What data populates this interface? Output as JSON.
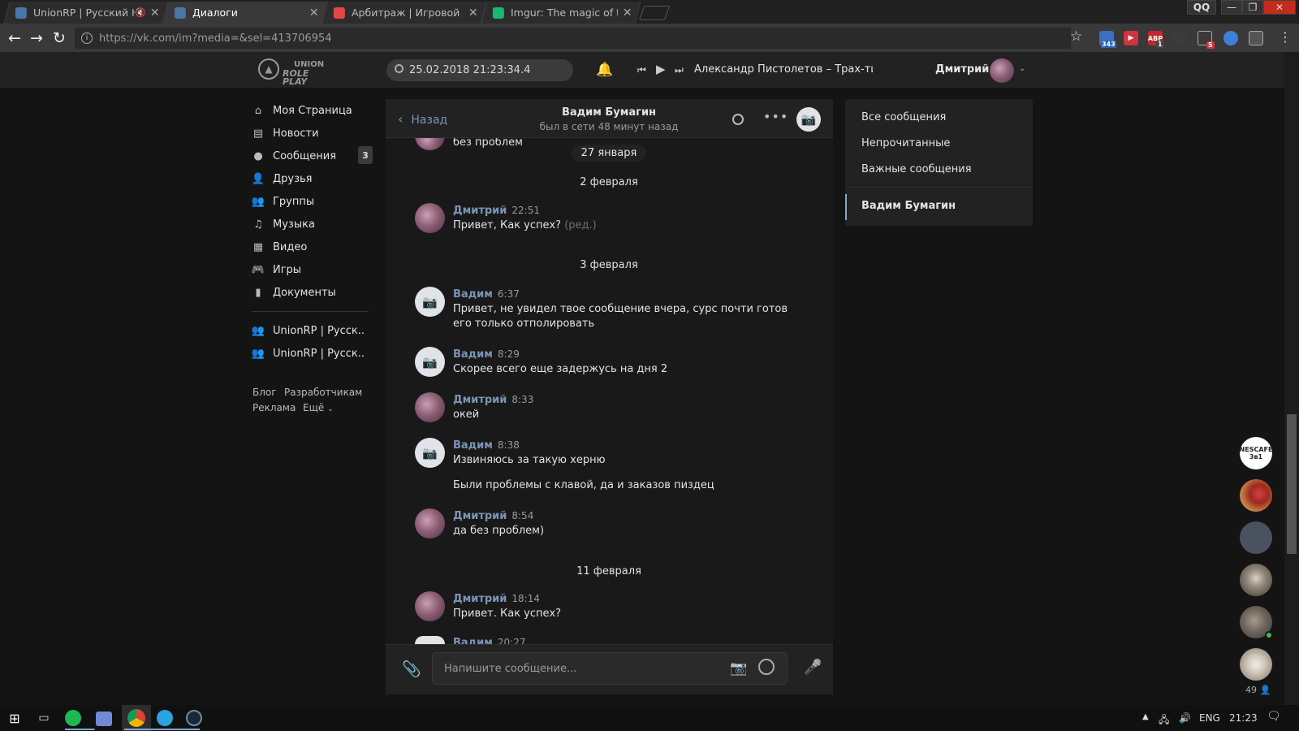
{
  "browser": {
    "tabs": [
      {
        "title": "UnionRP | Русский Hi",
        "muted": true,
        "favicon_color": "#4a76a8"
      },
      {
        "title": "Диалоги",
        "active": true,
        "favicon_color": "#4a76a8"
      },
      {
        "title": "Арбитраж | Игровой фо",
        "favicon_color": "#e04848"
      },
      {
        "title": "Imgur: The magic of the",
        "favicon_color": "#1bb76e"
      }
    ],
    "window_badge": "QQ",
    "url": "https://vk.com/im?media=&sel=413706954",
    "extensions": [
      {
        "name": "ext-weather-icon",
        "badge": "343",
        "color": "#3a6fc4"
      },
      {
        "name": "ext-video-icon",
        "badge": "",
        "color": "#d2333d"
      },
      {
        "name": "adblock-icon",
        "badge": "1",
        "label": "ABP",
        "color": "#c0282d"
      },
      {
        "name": "ext-gray-icon",
        "badge": "",
        "color": "#4a4a4a"
      },
      {
        "name": "ext-downloader-icon",
        "badge": "5",
        "color": "#555"
      },
      {
        "name": "ext-vpn-icon",
        "badge": "",
        "color": "#3f7fd8"
      },
      {
        "name": "ext-reader-icon",
        "badge": "",
        "color": "#888"
      }
    ]
  },
  "vk_header": {
    "logo_line1": "UNION",
    "logo_line2": "ROLE PLAY",
    "search_value": "25.02.2018 21:23:34.4",
    "now_playing": "Александр Пистолетов – Трах-тиб...",
    "user_name": "Дмитрий"
  },
  "left_menu": {
    "items": [
      {
        "label": "Моя Страница",
        "icon": "home-icon",
        "glyph": "⌂"
      },
      {
        "label": "Новости",
        "icon": "news-icon",
        "glyph": "▤"
      },
      {
        "label": "Сообщения",
        "icon": "messages-icon",
        "glyph": "●",
        "badge": "3"
      },
      {
        "label": "Друзья",
        "icon": "friends-icon",
        "glyph": "👤"
      },
      {
        "label": "Группы",
        "icon": "groups-icon",
        "glyph": "👥"
      },
      {
        "label": "Музыка",
        "icon": "music-icon",
        "glyph": "♫"
      },
      {
        "label": "Видео",
        "icon": "video-icon",
        "glyph": "▦"
      },
      {
        "label": "Игры",
        "icon": "games-icon",
        "glyph": "🎮"
      },
      {
        "label": "Документы",
        "icon": "documents-icon",
        "glyph": "▮"
      }
    ],
    "communities": [
      {
        "label": "UnionRP | Русск.."
      },
      {
        "label": "UnionRP | Русск.."
      }
    ],
    "footer": [
      "Блог",
      "Разработчикам",
      "Реклама",
      "Ещё"
    ]
  },
  "chat": {
    "back_label": "Назад",
    "peer_name": "Вадим Бумагин",
    "peer_status": "был в сети 48 минут назад",
    "cut_top_text": "без проблем",
    "dates": {
      "d1": "27 января",
      "d2": "2 февраля",
      "d3": "3 февраля",
      "d4": "11 февраля"
    },
    "messages": [
      {
        "author": "Дмитрий",
        "time": "22:51",
        "text": "Привет, Как успех?",
        "edited": "(ред.)"
      },
      {
        "author": "Вадим",
        "time": "6:37",
        "text": "Привет, не увидел твое сообщение вчера, сурс почти готов его только отполировать"
      },
      {
        "author": "Вадим",
        "time": "8:29",
        "text": "Скорее всего еще задержусь на дня 2"
      },
      {
        "author": "Дмитрий",
        "time": "8:33",
        "text": "окей"
      },
      {
        "author": "Вадим",
        "time": "8:38",
        "text": "Извиняюсь за такую херню",
        "text2": "Были проблемы с клавой, да и заказов пиздец"
      },
      {
        "author": "Дмитрий",
        "time": "8:54",
        "text": "да без проблем)"
      },
      {
        "author": "Дмитрий",
        "time": "18:14",
        "text": "Привет. Как успех?"
      },
      {
        "author": "Вадим",
        "time": "20:27"
      }
    ],
    "composer_placeholder": "Напишите сообщение..."
  },
  "filters": {
    "all": "Все сообщения",
    "unread": "Непрочитанные",
    "important": "Важные сообщения",
    "active_dialog": "Вадим Бумагин"
  },
  "friends_rail": {
    "count": "49",
    "first_label": "NESCAFE 3в1"
  },
  "taskbar": {
    "lang": "ENG",
    "clock": "21:23"
  }
}
